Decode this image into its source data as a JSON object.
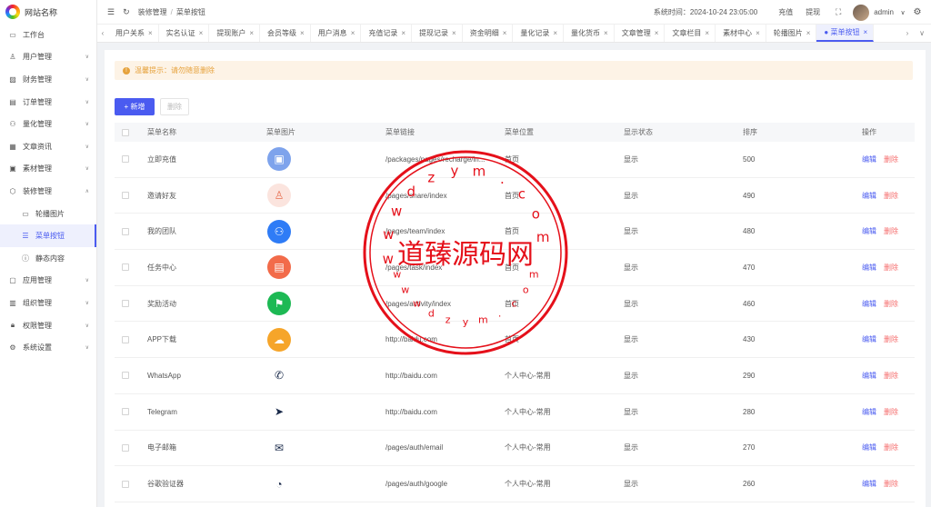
{
  "logo": {
    "text": "网站名称"
  },
  "sidebar": {
    "items": [
      {
        "label": "工作台",
        "icon": "monitor-icon",
        "glyph": "▭",
        "chevron": false
      },
      {
        "label": "用户管理",
        "icon": "user-icon",
        "glyph": "♙",
        "chevron": true
      },
      {
        "label": "财务管理",
        "icon": "chart-icon",
        "glyph": "▨",
        "chevron": true
      },
      {
        "label": "订单管理",
        "icon": "order-icon",
        "glyph": "▤",
        "chevron": true
      },
      {
        "label": "量化管理",
        "icon": "robot-icon",
        "glyph": "⚇",
        "chevron": true
      },
      {
        "label": "文章资讯",
        "icon": "article-icon",
        "glyph": "▦",
        "chevron": true
      },
      {
        "label": "素材管理",
        "icon": "image-icon",
        "glyph": "▣",
        "chevron": true
      },
      {
        "label": "装修管理",
        "icon": "decor-icon",
        "glyph": "⬡",
        "chevron": true,
        "expanded": true
      },
      {
        "label": "轮播图片",
        "icon": "picture-icon",
        "glyph": "▭",
        "sub": true
      },
      {
        "label": "菜单按钮",
        "icon": "list-icon",
        "glyph": "☰",
        "sub": true,
        "active": true
      },
      {
        "label": "静态内容",
        "icon": "info-icon",
        "glyph": "ⓘ",
        "sub": true
      },
      {
        "label": "应用管理",
        "icon": "app-icon",
        "glyph": "▢",
        "chevron": true
      },
      {
        "label": "组织管理",
        "icon": "org-icon",
        "glyph": "▥",
        "chevron": true
      },
      {
        "label": "权限管理",
        "icon": "lock-icon",
        "glyph": "🔒︎",
        "chevron": true
      },
      {
        "label": "系统设置",
        "icon": "gear-icon",
        "glyph": "⚙",
        "chevron": true
      }
    ]
  },
  "header": {
    "breadcrumb": [
      "装修管理",
      "菜单按钮"
    ],
    "sep": "/",
    "system_time": "系统时间：2024-10-24 23:05:00",
    "recharge": "充值",
    "withdraw": "提现",
    "user": "admin",
    "user_chevron": "∨"
  },
  "tabs": [
    {
      "label": "用户关系"
    },
    {
      "label": "实名认证"
    },
    {
      "label": "提现账户"
    },
    {
      "label": "会员等级"
    },
    {
      "label": "用户消息"
    },
    {
      "label": "充值记录"
    },
    {
      "label": "提现记录"
    },
    {
      "label": "资金明细"
    },
    {
      "label": "量化记录"
    },
    {
      "label": "量化货币"
    },
    {
      "label": "文章管理"
    },
    {
      "label": "文章栏目"
    },
    {
      "label": "素材中心"
    },
    {
      "label": "轮播图片"
    },
    {
      "label": "● 菜单按钮",
      "active": true
    }
  ],
  "notice": {
    "text": "温馨提示：请勿随意删除"
  },
  "toolbar": {
    "add_label": "+ 新增",
    "delete_label": "删除"
  },
  "table": {
    "columns": [
      "菜单名称",
      "菜单图片",
      "菜单链接",
      "菜单位置",
      "显示状态",
      "排序",
      "操作"
    ],
    "edit_label": "编辑",
    "delete_label": "删除",
    "rows": [
      {
        "name": "立即充值",
        "icon": "recharge-icon",
        "icon_class": "ic-recharge",
        "glyph": "▣",
        "link": "/packages/pages/recharge/in...",
        "position": "首页",
        "status": "显示",
        "sort": "500"
      },
      {
        "name": "邀请好友",
        "icon": "invite-icon",
        "icon_class": "ic-invite",
        "glyph": "♙",
        "link": "/pages/share/index",
        "position": "首页",
        "status": "显示",
        "sort": "490"
      },
      {
        "name": "我的团队",
        "icon": "team-icon",
        "icon_class": "ic-team",
        "glyph": "⚇",
        "link": "/pages/team/index",
        "position": "首页",
        "status": "显示",
        "sort": "480"
      },
      {
        "name": "任务中心",
        "icon": "task-icon",
        "icon_class": "ic-task",
        "glyph": "▤",
        "link": "/pages/task/index",
        "position": "首页",
        "status": "显示",
        "sort": "470"
      },
      {
        "name": "奖励活动",
        "icon": "reward-icon",
        "icon_class": "ic-reward",
        "glyph": "⚑",
        "link": "/pages/activity/index",
        "position": "首页",
        "status": "显示",
        "sort": "460"
      },
      {
        "name": "APP下载",
        "icon": "cloud-download-icon",
        "icon_class": "ic-app",
        "glyph": "☁",
        "link": "http://baidu.com",
        "position": "首页",
        "status": "显示",
        "sort": "430"
      },
      {
        "name": "WhatsApp",
        "icon": "whatsapp-icon",
        "icon_class": "ic-plain",
        "glyph": "✆",
        "link": "http://baidu.com",
        "position": "个人中心-常用",
        "status": "显示",
        "sort": "290"
      },
      {
        "name": "Telegram",
        "icon": "telegram-icon",
        "icon_class": "ic-plain",
        "glyph": "➤",
        "link": "http://baidu.com",
        "position": "个人中心-常用",
        "status": "显示",
        "sort": "280"
      },
      {
        "name": "电子邮箱",
        "icon": "email-icon",
        "icon_class": "ic-plain",
        "glyph": "✉",
        "link": "/pages/auth/email",
        "position": "个人中心-常用",
        "status": "显示",
        "sort": "270"
      },
      {
        "name": "谷歌验证器",
        "icon": "google-auth-icon",
        "icon_class": "ic-plain",
        "glyph": "◔",
        "link": "/pages/auth/google",
        "position": "个人中心-常用",
        "status": "显示",
        "sort": "260"
      }
    ]
  },
  "watermark": {
    "text": "道臻源码网",
    "ring_text": "wwwdzym.com"
  }
}
